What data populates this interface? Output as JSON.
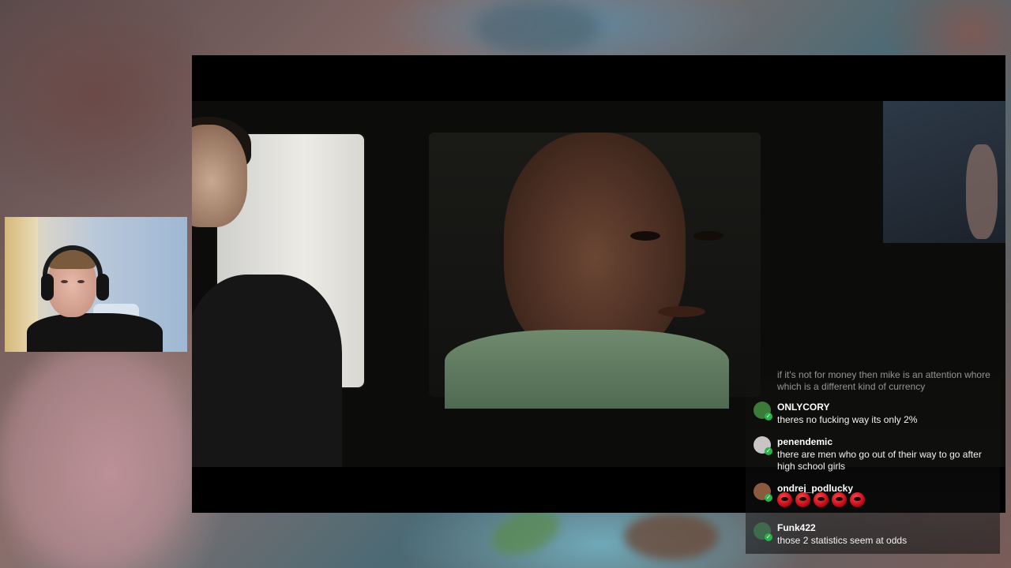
{
  "chat": {
    "messages": [
      {
        "username": "",
        "text": "if it's not for money then mike is an attention whore which is a different kind of currency",
        "avatar_color": "#5a5a5a",
        "faded": true
      },
      {
        "username": "ONLYCORY",
        "text": "theres no fucking way its only 2%",
        "avatar_color": "#3c7a3a"
      },
      {
        "username": "penendemic",
        "text": "there are men who go out of their way to go after high school girls",
        "avatar_color": "#c9c4c6"
      },
      {
        "username": "ondrej_podlucky",
        "emote_count": 5,
        "emote_name": "red-face-emote",
        "avatar_color": "#8a5a3e"
      },
      {
        "username": "Funk422",
        "text": "those 2 statistics seem at odds",
        "avatar_color": "#3f6a4e"
      }
    ],
    "mod_badge_icon": "moderator-badge-icon"
  },
  "colors": {
    "chat_text": "#f2f2f2",
    "mod_badge": "#2bb24c",
    "video_bg": "#000000"
  }
}
